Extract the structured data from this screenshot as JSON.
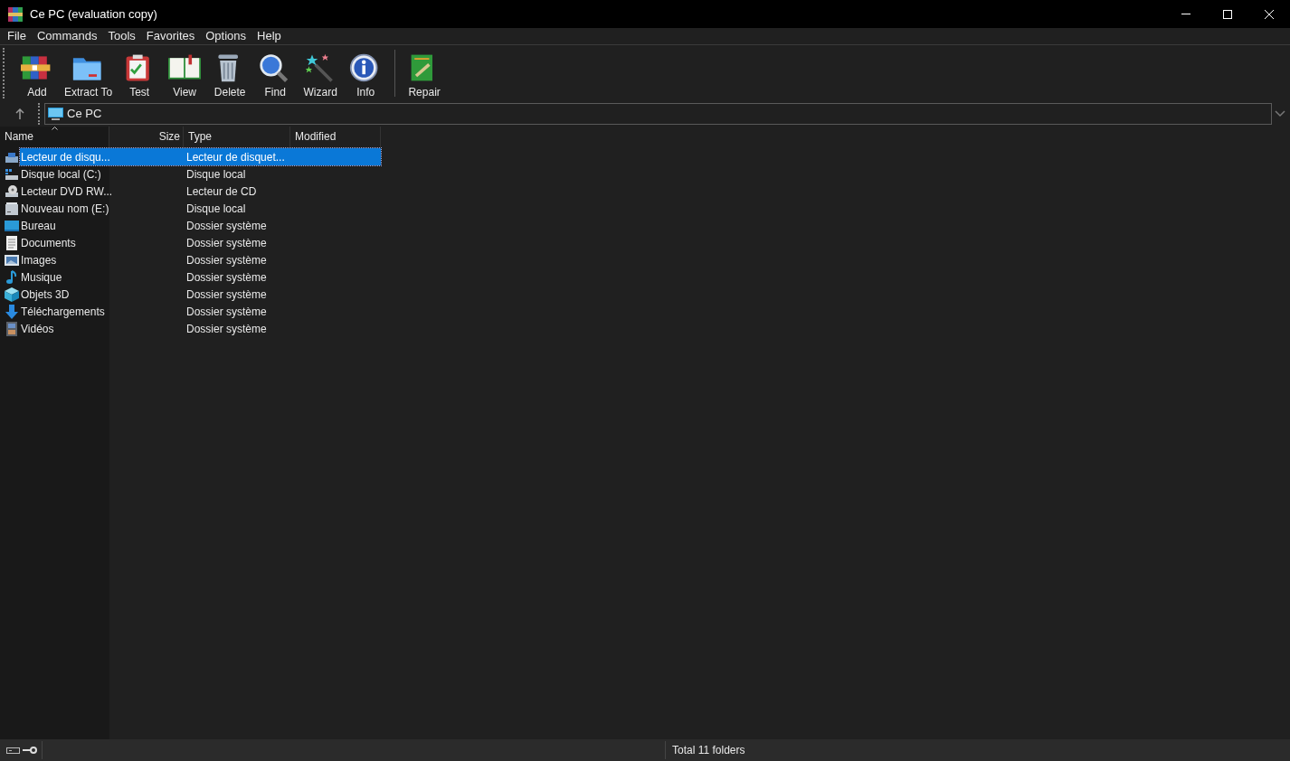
{
  "window": {
    "title": "Ce PC (evaluation copy)"
  },
  "menu": [
    "File",
    "Commands",
    "Tools",
    "Favorites",
    "Options",
    "Help"
  ],
  "toolbar": {
    "buttons": [
      {
        "label": "Add",
        "kind": "archive"
      },
      {
        "label": "Extract To",
        "kind": "folder"
      },
      {
        "label": "Test",
        "kind": "clipboard"
      },
      {
        "label": "View",
        "kind": "book"
      },
      {
        "label": "Delete",
        "kind": "trash"
      },
      {
        "label": "Find",
        "kind": "magnifier"
      },
      {
        "label": "Wizard",
        "kind": "wand"
      },
      {
        "label": "Info",
        "kind": "info"
      },
      {
        "label": "Repair",
        "kind": "repair",
        "separated": true
      }
    ]
  },
  "address": {
    "value": "Ce PC"
  },
  "table": {
    "columns": [
      {
        "label": "Name",
        "sorted": true
      },
      {
        "label": "Size",
        "sorted": false
      },
      {
        "label": "Type",
        "sorted": false
      },
      {
        "label": "Modified",
        "sorted": false
      }
    ],
    "rows": [
      {
        "name": "Lecteur de disqu...",
        "type": "Lecteur de disquet...",
        "kind": "floppy",
        "selected": true
      },
      {
        "name": "Disque local (C:)",
        "type": "Disque local",
        "kind": "system-drive",
        "selected": false
      },
      {
        "name": "Lecteur DVD RW...",
        "type": "Lecteur de CD",
        "kind": "dvd",
        "selected": false
      },
      {
        "name": "Nouveau nom (E:)",
        "type": "Disque local",
        "kind": "drive",
        "selected": false
      },
      {
        "name": "Bureau",
        "type": "Dossier système",
        "kind": "desktop",
        "selected": false
      },
      {
        "name": "Documents",
        "type": "Dossier système",
        "kind": "documents",
        "selected": false
      },
      {
        "name": "Images",
        "type": "Dossier système",
        "kind": "pictures",
        "selected": false
      },
      {
        "name": "Musique",
        "type": "Dossier système",
        "kind": "music",
        "selected": false
      },
      {
        "name": "Objets 3D",
        "type": "Dossier système",
        "kind": "cube",
        "selected": false
      },
      {
        "name": "Téléchargements",
        "type": "Dossier système",
        "kind": "download",
        "selected": false
      },
      {
        "name": "Vidéos",
        "type": "Dossier système",
        "kind": "video",
        "selected": false
      }
    ]
  },
  "status_bar": {
    "text": "Total 11 folders"
  }
}
